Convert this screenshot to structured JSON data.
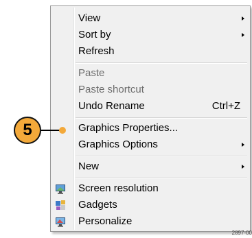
{
  "menu": {
    "items": [
      {
        "label": "View",
        "submenu": true
      },
      {
        "label": "Sort by",
        "submenu": true
      },
      {
        "label": "Refresh"
      },
      {
        "label": "Paste",
        "disabled": true
      },
      {
        "label": "Paste shortcut",
        "disabled": true
      },
      {
        "label": "Undo Rename",
        "shortcut": "Ctrl+Z"
      },
      {
        "label": "Graphics Properties..."
      },
      {
        "label": "Graphics Options",
        "submenu": true
      },
      {
        "label": "New",
        "submenu": true
      },
      {
        "label": "Screen resolution",
        "icon": "monitor-icon"
      },
      {
        "label": "Gadgets",
        "icon": "gadgets-icon"
      },
      {
        "label": "Personalize",
        "icon": "personalize-icon"
      }
    ]
  },
  "callout": {
    "number": "5",
    "color": "#f3a93a"
  },
  "figure_code": "2897-00"
}
